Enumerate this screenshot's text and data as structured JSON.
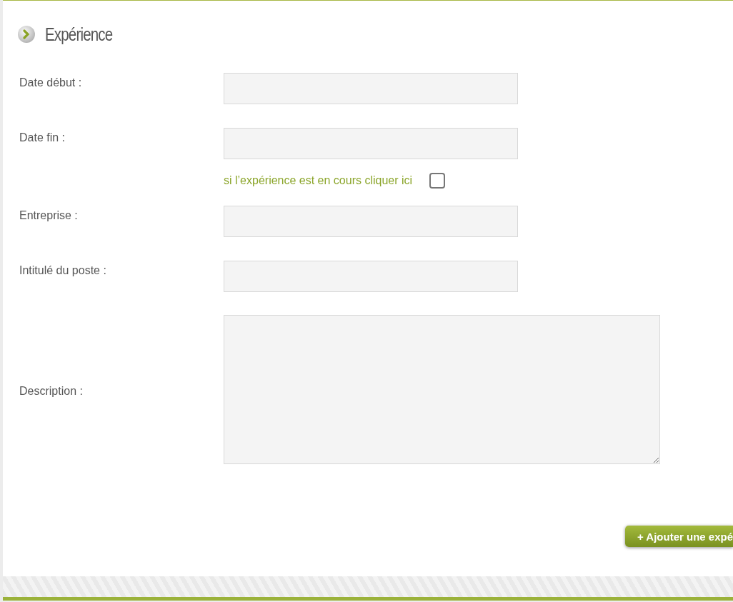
{
  "section": {
    "title": "Expérience"
  },
  "fields": [
    {
      "kind": "input",
      "label": "Date début :"
    },
    {
      "kind": "input",
      "label": "Date fin :"
    },
    {
      "kind": "checkbox",
      "label": "si l’expérience est en cours cliquer ici",
      "checked": false
    },
    {
      "kind": "input",
      "label": "Entreprise :"
    },
    {
      "kind": "input",
      "label": "Intitulé du poste :"
    },
    {
      "kind": "textarea",
      "label": "Description :"
    }
  ],
  "add_button": {
    "label": "+ Ajouter une expé"
  }
}
